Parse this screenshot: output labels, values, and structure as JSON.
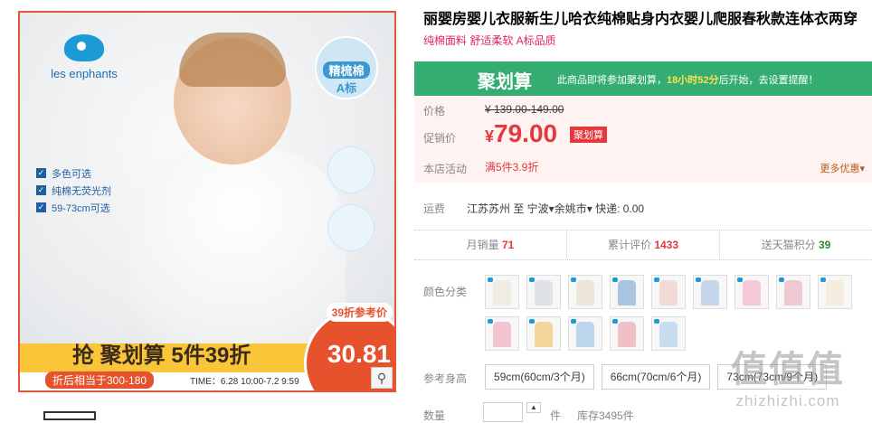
{
  "gallery": {
    "brand": "les enphants",
    "badge_line1": "精梳棉",
    "badge_line2": "A标",
    "features": [
      "多色可选",
      "纯棉无荧光剂",
      "59-73cm可选"
    ],
    "banner_title_a": "抢 聚划算 ",
    "banner_title_b": "5件39折",
    "banner_sub": "折后相当于300-180",
    "banner_time": "TIME：6.28 10:00-7.2 9:59",
    "price_tag": "39折参考价",
    "price_num": "30.81"
  },
  "product": {
    "title": "丽婴房婴儿衣服新生儿哈衣纯棉贴身内衣婴儿爬服春秋款连体衣两穿",
    "subtitle": "纯棉面料 舒适柔软 A标品质"
  },
  "juhuasuan": {
    "logo": "聚划算",
    "text_pre": "此商品即将参加聚划算，",
    "text_highlight": "18小时52分",
    "text_post": "后开始，去设置提醒！"
  },
  "price": {
    "label_price": "价格",
    "original": "¥ 139.00-149.00",
    "label_promo": "促销价",
    "currency": "¥",
    "promo": "79.00",
    "promo_tag": "聚划算",
    "label_shop": "本店活动",
    "shop_activity": "满5件3.9折",
    "more_offers": "更多优惠▾"
  },
  "shipping": {
    "label": "运费",
    "text": "江苏苏州 至 宁波▾余姚市▾ 快递: 0.00"
  },
  "stats": [
    {
      "label": "月销量",
      "value": "71"
    },
    {
      "label": "累计评价",
      "value": "1433"
    },
    {
      "label": "送天猫积分",
      "value": "39"
    }
  ],
  "colors": {
    "label": "颜色分类",
    "swatches": [
      "#f1ece2",
      "#dfe3e8",
      "#ece7da",
      "#a9c4e0",
      "#f2dad6",
      "#c6d6ea",
      "#f3c9d7",
      "#f0c8d2",
      "#f6ecde",
      "#f2c4cf",
      "#f1d59a",
      "#bcd6ee",
      "#efc1c7",
      "#c8dcf0"
    ]
  },
  "sizes": {
    "label": "参考身高",
    "options": [
      "59cm(60cm/3个月)",
      "66cm(70cm/6个月)",
      "73cm(73cm/9个月)"
    ]
  },
  "quantity": {
    "label": "数量",
    "unit": "件",
    "stock": "库存3495件"
  },
  "watermark": {
    "line1": "值值值",
    "line2": "zhizhizhi.com"
  }
}
